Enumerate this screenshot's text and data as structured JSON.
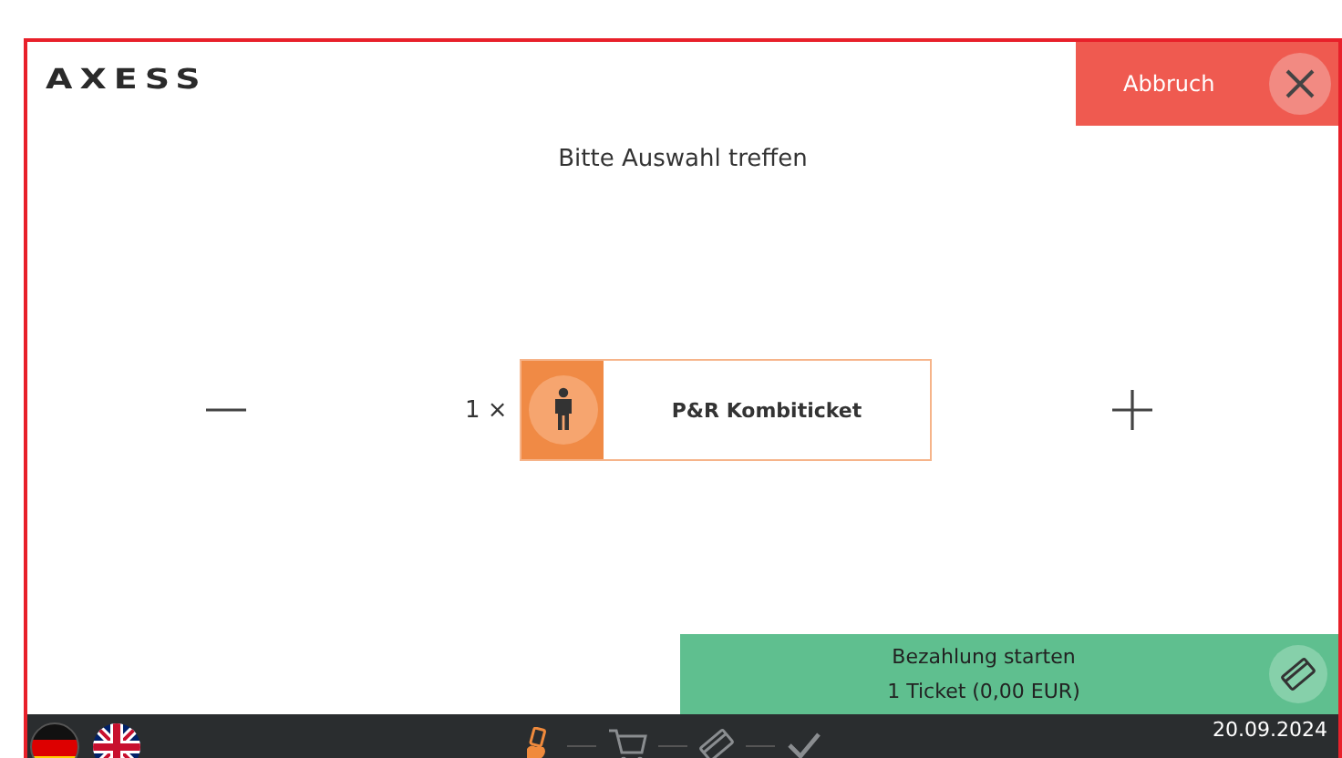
{
  "logo": "AXESS",
  "cancel_button": {
    "label": "Abbruch"
  },
  "title": "Bitte Auswahl treffen",
  "product": {
    "quantity": "1 ×",
    "name": "P&R Kombiticket"
  },
  "pay_button": {
    "label": "Bezahlung starten",
    "summary": "1 Ticket (0,00 EUR)"
  },
  "footer": {
    "languages": [
      {
        "kind": "de"
      },
      {
        "kind": "en"
      }
    ],
    "steps": [
      {
        "kind": "select",
        "selected": true
      },
      {
        "kind": "cart",
        "selected": false
      },
      {
        "kind": "card",
        "selected": false
      },
      {
        "kind": "done",
        "selected": false
      }
    ],
    "date": "20.09.2024"
  }
}
